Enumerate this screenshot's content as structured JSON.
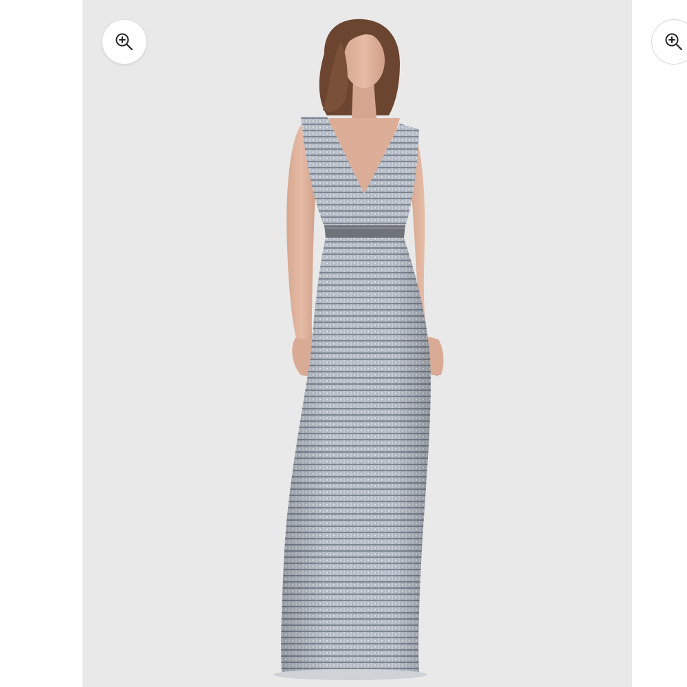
{
  "gallery": {
    "main_slide": {
      "zoom_button": {
        "icon": "zoom-in-icon"
      },
      "photo": {
        "subject": "model-in-silver-gown-photo",
        "background": "#e9e9e9",
        "gown_color": "#a9b0ba"
      }
    },
    "next_slide": {
      "zoom_button": {
        "icon": "zoom-in-icon"
      }
    }
  }
}
